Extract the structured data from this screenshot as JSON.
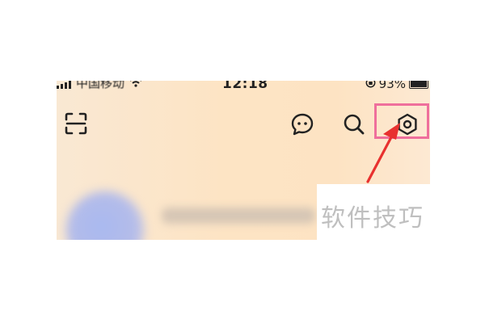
{
  "status_bar": {
    "carrier": "中国移动",
    "time": "12:18",
    "battery_percent": "93%",
    "battery_level": 0.93
  },
  "header": {
    "left_icon": "scan-icon",
    "right_icons": [
      "chat-bubble-icon",
      "search-icon",
      "settings-hexagon-icon"
    ]
  },
  "annotation": {
    "highlight_color": "#ef6f9c",
    "arrow_color": "#e8312f"
  },
  "watermark": {
    "text": "软件技巧"
  },
  "colors": {
    "background_gradient": [
      "#f9e8d3",
      "#fde3c3"
    ],
    "icon_color": "#222222"
  }
}
